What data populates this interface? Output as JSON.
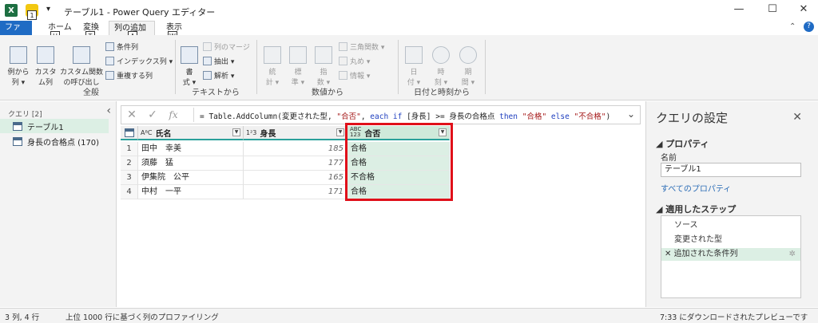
{
  "window": {
    "app_icon": "X",
    "quick_access_badge": "1",
    "title": "テーブル1 - Power Query エディター",
    "controls": [
      "—",
      "☐",
      "✕"
    ]
  },
  "tabs": [
    {
      "label": "ファイル",
      "key": "F"
    },
    {
      "label": "ホーム",
      "key": "H"
    },
    {
      "label": "変換",
      "key": "T"
    },
    {
      "label": "列の追加",
      "key": "A"
    },
    {
      "label": "表示",
      "key": "W"
    }
  ],
  "ribbon": {
    "general": {
      "label": "全般",
      "example_column": "例から\n列 ▾",
      "custom_column": "カスタ\nム列",
      "custom_function": "カスタム関数\nの呼び出し",
      "conditional_column": "条件列",
      "index_column": "インデックス列 ▾",
      "duplicate_column": "重複する列"
    },
    "text": {
      "label": "テキストから",
      "format": "書\n式 ▾",
      "merge_columns": "列のマージ",
      "extract": "抽出 ▾",
      "parse": "解析 ▾"
    },
    "number": {
      "label": "数値から",
      "statistics": "統\n計 ▾",
      "standard": "標\n準 ▾",
      "scientific": "指\n数 ▾",
      "trigonometry": "三角関数 ▾",
      "rounding": "丸め ▾",
      "information": "情報 ▾"
    },
    "datetime": {
      "label": "日付と時刻から",
      "date": "日\n付 ▾",
      "time": "時\n刻 ▾",
      "duration": "期\n間 ▾"
    }
  },
  "queries": {
    "header": "クエリ [2]",
    "items": [
      {
        "label": "テーブル1"
      },
      {
        "label": "身長の合格点 (170)"
      }
    ]
  },
  "formula": {
    "prefix": "= Table.AddColumn(変更された型, ",
    "s1": "\"合否\"",
    "mid1": ", ",
    "kw1": "each if",
    "mid2": " [身長] >= 身長の合格点 ",
    "kw2": "then",
    "mid3": " ",
    "s2": "\"合格\"",
    "mid4": " ",
    "kw3": "else",
    "mid5": " ",
    "s3": "\"不合格\"",
    "suffix": ")"
  },
  "table": {
    "columns": [
      {
        "type": "AᴮC",
        "name": "氏名"
      },
      {
        "type": "1²3",
        "name": "身長"
      },
      {
        "type": "ABC\n123",
        "name": "合否"
      }
    ],
    "rows": [
      {
        "n": "1",
        "name": "田中　幸美",
        "height": "185",
        "result": "合格"
      },
      {
        "n": "2",
        "name": "須藤　猛",
        "height": "177",
        "result": "合格"
      },
      {
        "n": "3",
        "name": "伊集院　公平",
        "height": "165",
        "result": "不合格"
      },
      {
        "n": "4",
        "name": "中村　一平",
        "height": "171",
        "result": "合格"
      }
    ]
  },
  "settings": {
    "title": "クエリの設定",
    "properties_header": "◢ プロパティ",
    "name_label": "名前",
    "name_value": "テーブル1",
    "all_properties": "すべてのプロパティ",
    "steps_header": "◢ 適用したステップ",
    "steps": [
      {
        "label": "ソース"
      },
      {
        "label": "変更された型"
      },
      {
        "label": "✕ 追加された条件列"
      }
    ]
  },
  "status": {
    "left": "3 列, 4 行",
    "middle": "上位 1000 行に基づく列のプロファイリング",
    "right": "7:33 にダウンロードされたプレビューです"
  },
  "accent": "#2aa09a",
  "highlight": "#e0101a"
}
